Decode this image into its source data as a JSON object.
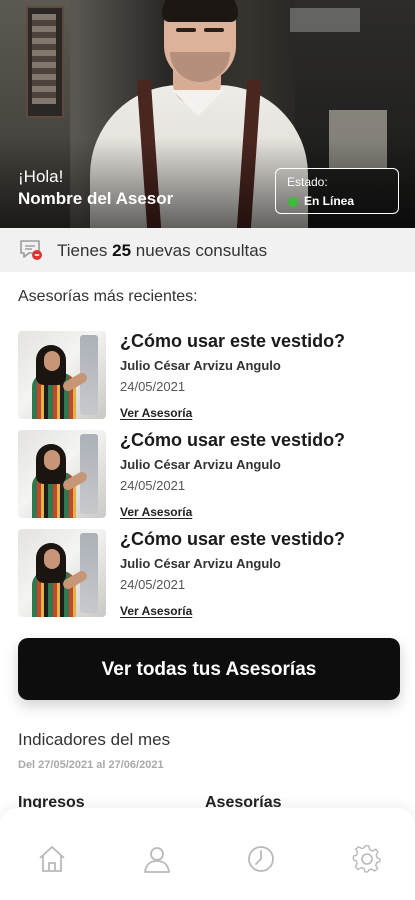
{
  "hero": {
    "greeting": "¡Hola!",
    "advisor_name": "Nombre del Asesor",
    "status_label": "Estado:",
    "status_value": "En Línea",
    "status_color": "#3bbd3b"
  },
  "notice": {
    "prefix": "Tienes",
    "count": "25",
    "suffix": "nuevas consultas",
    "icon": "chat-alert-icon"
  },
  "recent": {
    "title": "Asesorías más recientes:",
    "items": [
      {
        "title": "¿Cómo usar este vestido?",
        "client": "Julio César Arvizu Angulo",
        "date": "24/05/2021",
        "link": "Ver Asesoría"
      },
      {
        "title": "¿Cómo usar este vestido?",
        "client": "Julio César Arvizu Angulo",
        "date": "24/05/2021",
        "link": "Ver Asesoría"
      },
      {
        "title": "¿Cómo usar este vestido?",
        "client": "Julio César Arvizu Angulo",
        "date": "24/05/2021",
        "link": "Ver Asesoría"
      }
    ]
  },
  "cta": {
    "label": "Ver todas tus Asesorías"
  },
  "indicators": {
    "title": "Indicadores del mes",
    "range": "Del 27/05/2021 al 27/06/2021",
    "col_left": "Ingresos",
    "col_right": "Asesorías"
  },
  "nav": {
    "items": [
      {
        "icon": "home-icon"
      },
      {
        "icon": "user-icon"
      },
      {
        "icon": "clock-icon"
      },
      {
        "icon": "gear-icon"
      }
    ]
  },
  "colors": {
    "accent": "#0d0d0d",
    "online": "#3bbd3b",
    "notice_bg": "#f1f1f1"
  }
}
